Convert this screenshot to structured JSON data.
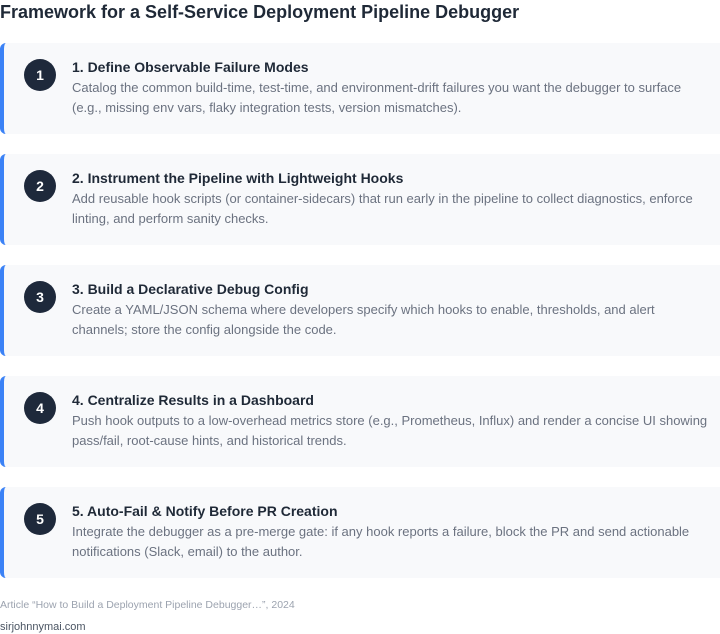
{
  "title": "Framework for a Self-Service Deployment Pipeline Debugger",
  "steps": [
    {
      "number": "1",
      "title": "1. Define Observable Failure Modes",
      "description": "Catalog the common build-time, test-time, and environment-drift failures you want the debugger to surface (e.g., missing env vars, flaky integration tests, version mismatches)."
    },
    {
      "number": "2",
      "title": "2. Instrument the Pipeline with Lightweight Hooks",
      "description": "Add reusable hook scripts (or container-sidecars) that run early in the pipeline to collect diagnostics, enforce linting, and perform sanity checks."
    },
    {
      "number": "3",
      "title": "3. Build a Declarative Debug Config",
      "description": "Create a YAML/JSON schema where developers specify which hooks to enable, thresholds, and alert channels; store the config alongside the code."
    },
    {
      "number": "4",
      "title": "4. Centralize Results in a Dashboard",
      "description": "Push hook outputs to a low-overhead metrics store (e.g., Prometheus, Influx) and render a concise UI showing pass/fail, root-cause hints, and historical trends."
    },
    {
      "number": "5",
      "title": "5. Auto-Fail & Notify Before PR Creation",
      "description": "Integrate the debugger as a pre-merge gate: if any hook reports a failure, block the PR and send actionable notifications (Slack, email) to the author."
    }
  ],
  "footer": {
    "source": "Article “How to Build a Deployment Pipeline Debugger…”, 2024",
    "site": "sirjohnnymai.com"
  },
  "colors": {
    "accent": "#3b82f6",
    "badge": "#1e293b",
    "card_bg": "#f8f9fb"
  }
}
